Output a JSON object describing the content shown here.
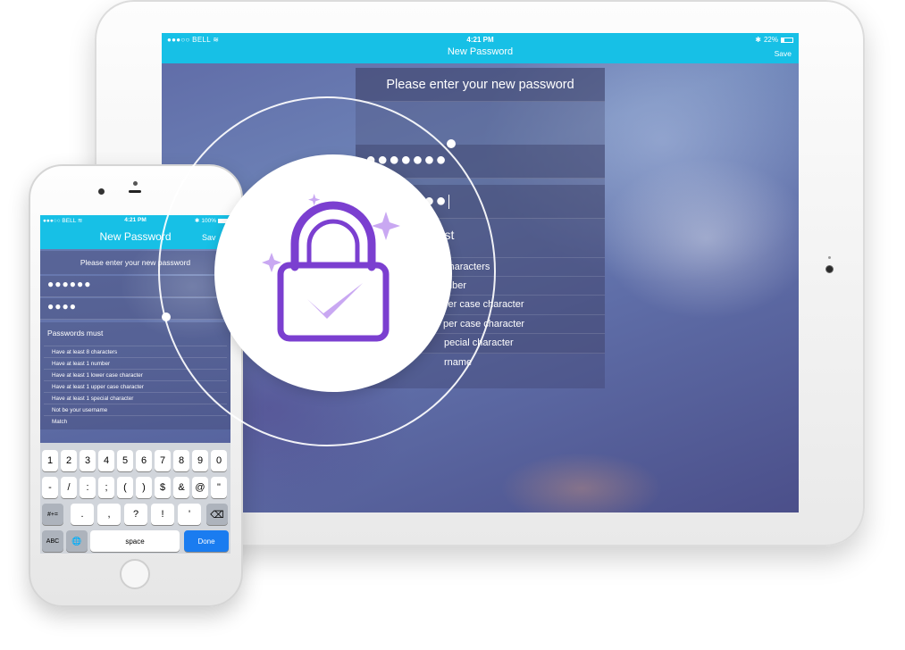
{
  "tablet": {
    "status": {
      "carrier": "●●●○○ BELL ",
      "time": "4:21 PM",
      "battery": "22%"
    },
    "nav": {
      "title": "New Password",
      "save_label": "Save"
    },
    "prompt": "Please enter your new password",
    "password_masked": "●●●●●●●",
    "confirm_masked": "●●●●●●●",
    "rules_header_visible": "must",
    "rules_visible": [
      "characters",
      "mber",
      "ver case character",
      "per case character",
      "pecial character",
      "rname"
    ]
  },
  "phone": {
    "status": {
      "carrier": "●●●○○ BELL ",
      "time": "4:21 PM",
      "battery": "100%"
    },
    "nav": {
      "title": "New Password",
      "save_label": "Sav"
    },
    "prompt": "Please enter your new password",
    "password_masked": "●●●●●●",
    "confirm_masked": "●●●●",
    "rules_header": "Passwords must",
    "rules": [
      "Have at least 8 characters",
      "Have at least 1 number",
      "Have at least 1 lower case character",
      "Have at least 1 upper case character",
      "Have at least 1 special character",
      "Not be your username",
      "Match"
    ],
    "keyboard": {
      "row1": [
        "1",
        "2",
        "3",
        "4",
        "5",
        "6",
        "7",
        "8",
        "9",
        "0"
      ],
      "row2": [
        "-",
        "/",
        ":",
        ";",
        "(",
        ")",
        "$",
        "&",
        "@",
        "\""
      ],
      "row3": {
        "symbols_key": "#+=",
        "keys": [
          ".",
          ",",
          "?",
          "!",
          "'"
        ],
        "delete_key": "⌫"
      },
      "row4": {
        "abc_key": "ABC",
        "globe_key": "🌐",
        "space_label": "space",
        "done_label": "Done"
      }
    }
  },
  "badge": {
    "icon": "lock-check-icon",
    "accent": "#7b3fd0",
    "check_color": "#c9a8f2"
  },
  "colors": {
    "nav_bar": "#17c0e6",
    "done_key": "#1a7cf0"
  }
}
